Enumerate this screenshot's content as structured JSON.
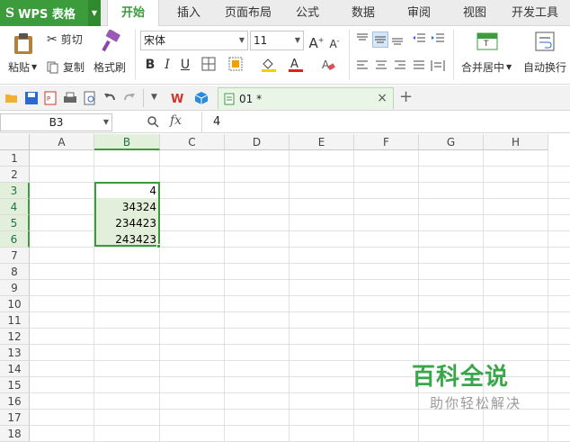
{
  "app": {
    "title": "WPS 表格",
    "logo_glyph": "S"
  },
  "menu": {
    "tabs": [
      {
        "label": "开始",
        "active": true
      },
      {
        "label": "插入"
      },
      {
        "label": "页面布局"
      },
      {
        "label": "公式"
      },
      {
        "label": "数据"
      },
      {
        "label": "审阅"
      },
      {
        "label": "视图"
      },
      {
        "label": "开发工具"
      }
    ]
  },
  "ribbon": {
    "paste": "粘贴",
    "cut": "剪切",
    "copy": "复制",
    "format_painter": "格式刷",
    "font_name": "宋体",
    "font_size": "11",
    "bold": "B",
    "italic": "I",
    "underline": "U",
    "grow_font": "A",
    "shrink_font": "A",
    "merge_center": "合并居中",
    "wrap_text": "自动换行"
  },
  "quickbar": {
    "doc_tab": "01 *"
  },
  "formula_bar": {
    "name_box": "B3",
    "fx": "fx",
    "value": "4"
  },
  "sheet": {
    "columns": [
      "A",
      "B",
      "C",
      "D",
      "E",
      "F",
      "G",
      "H"
    ],
    "selected_column": "B",
    "rows": [
      "1",
      "2",
      "3",
      "4",
      "5",
      "6",
      "7",
      "8",
      "9",
      "10",
      "11",
      "12",
      "13",
      "14",
      "15",
      "16",
      "17",
      "18"
    ],
    "selected_rows": [
      "3",
      "4",
      "5",
      "6"
    ],
    "cells": {
      "B3": "4",
      "B4": "34324",
      "B5": "234423",
      "B6": "243423"
    }
  },
  "watermark": {
    "title": "百科全说",
    "subtitle": "助你轻松解决"
  },
  "colors": {
    "accent": "#3c9b3b",
    "selection": "#e2efda",
    "watermark": "#3aa64a"
  }
}
